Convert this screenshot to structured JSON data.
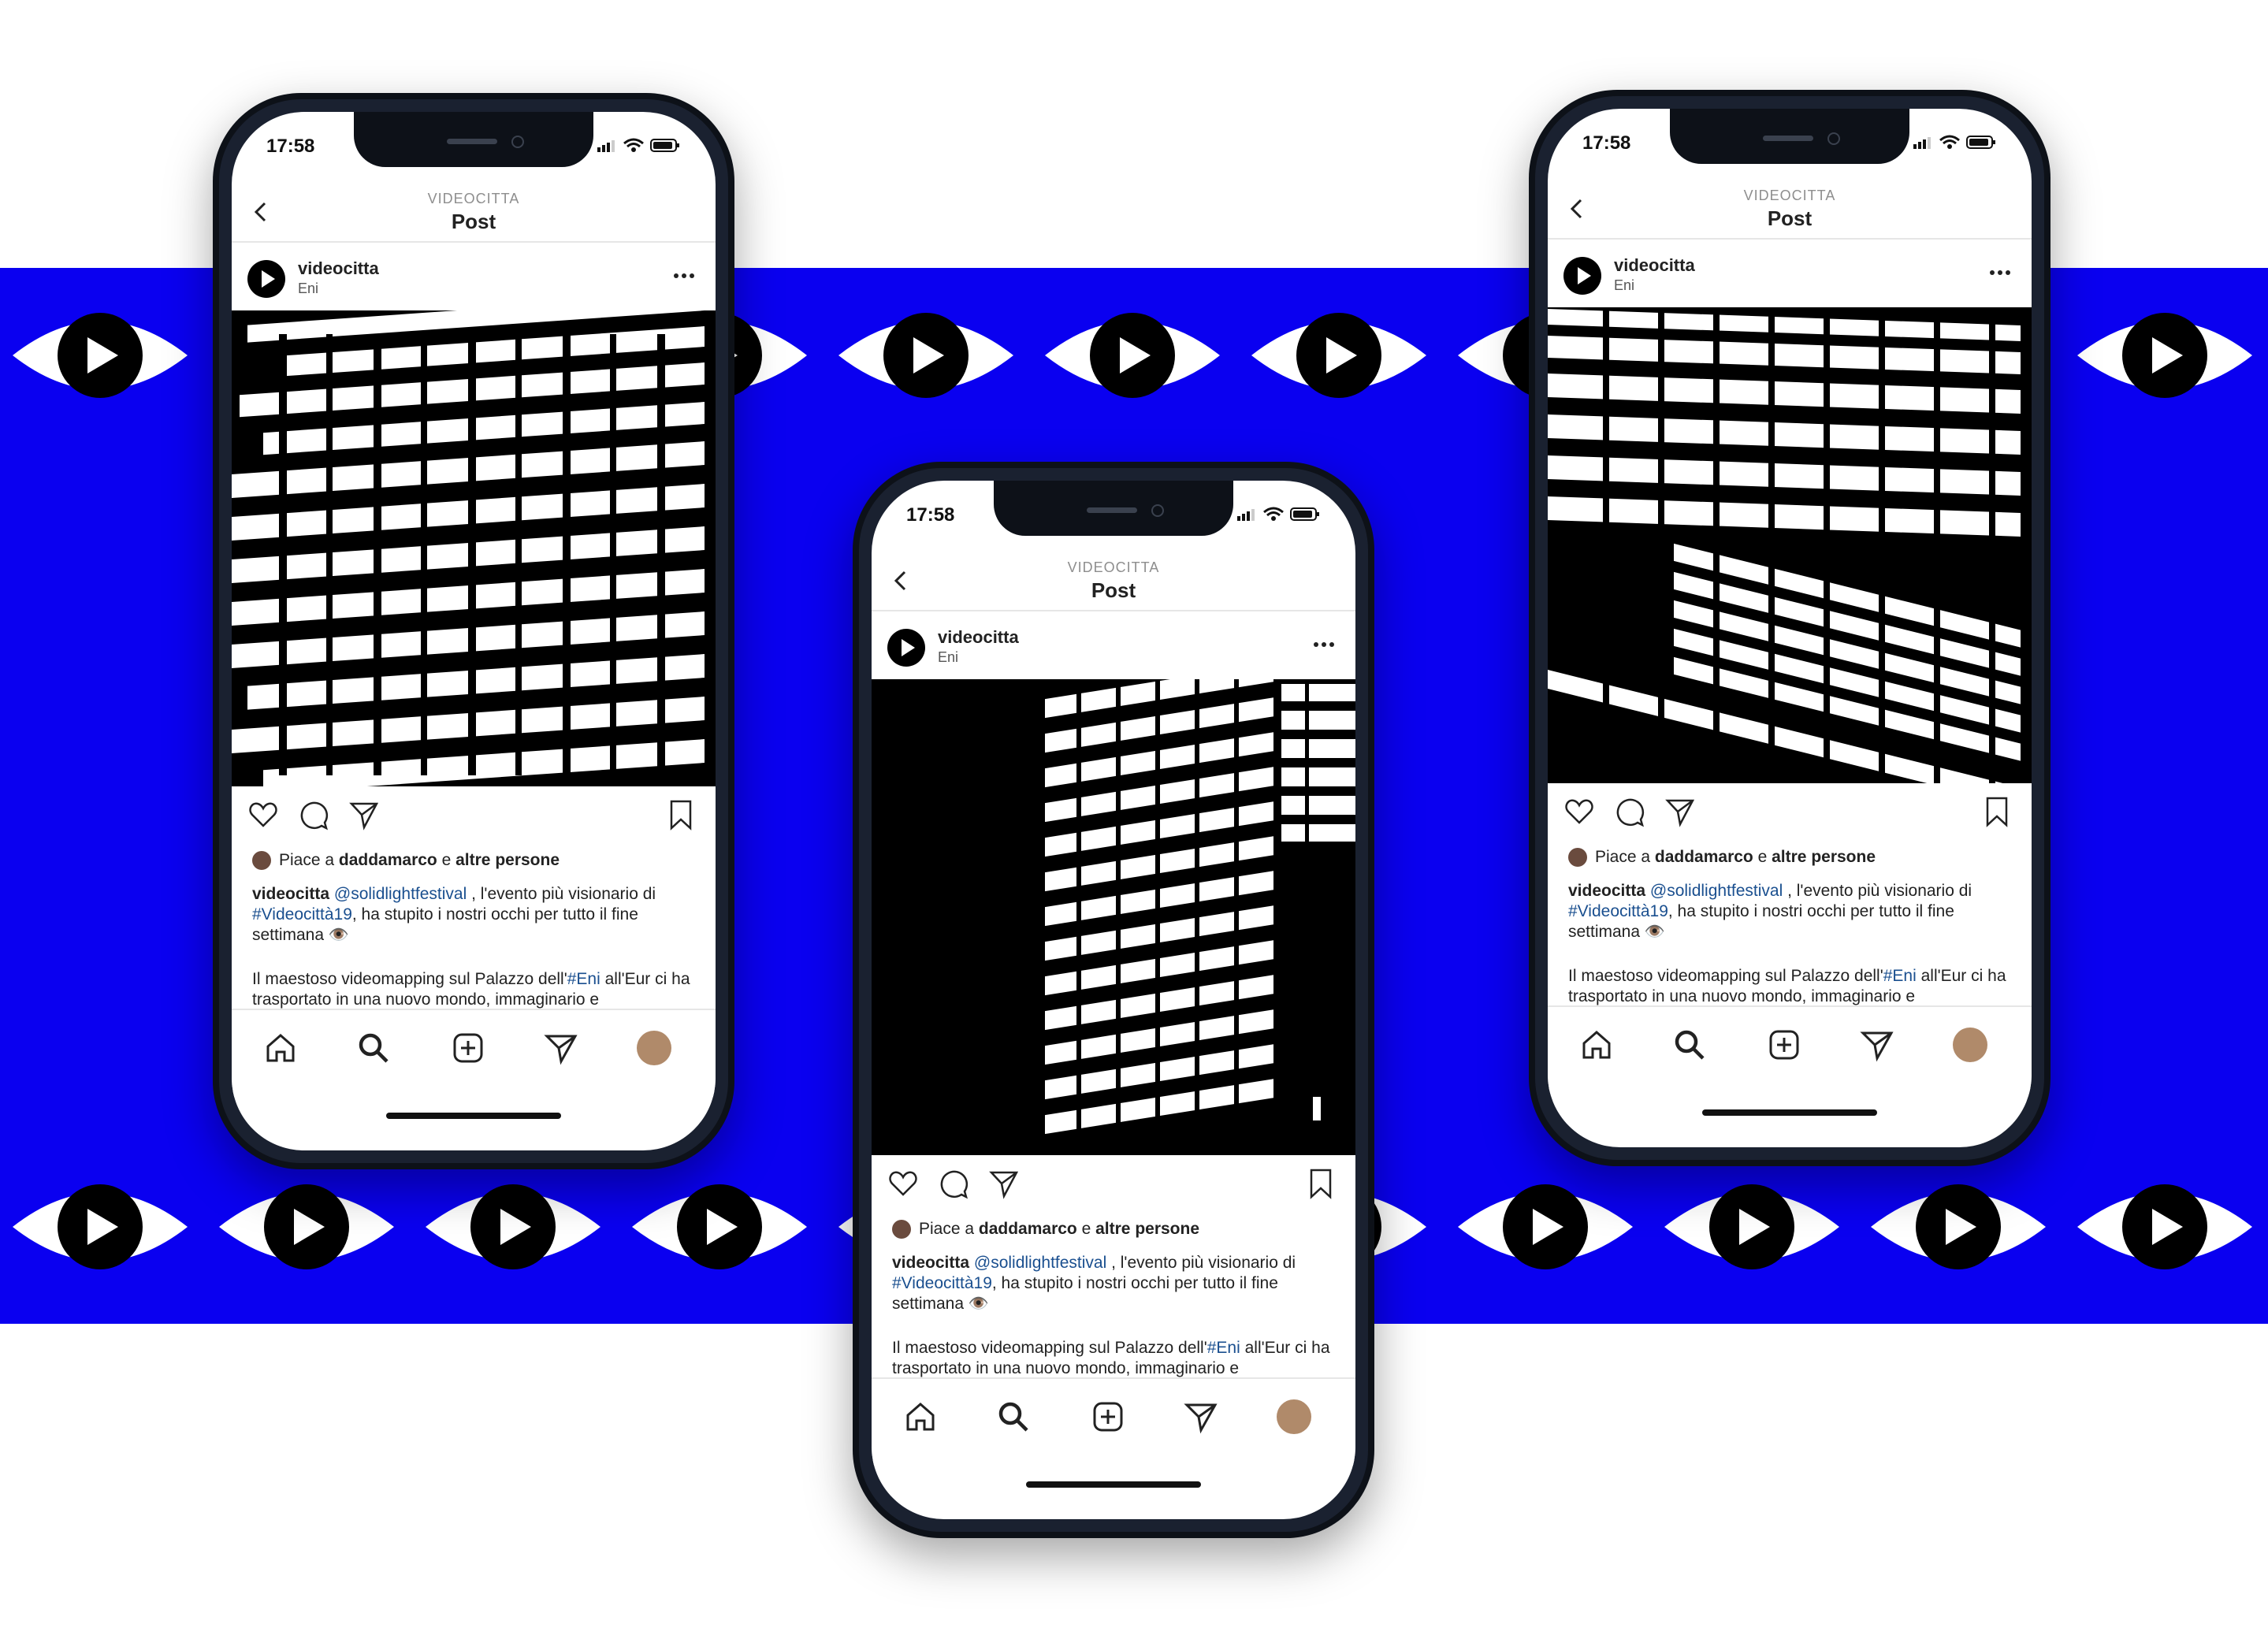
{
  "colors": {
    "band": "#0a00f0",
    "link": "#1a4f8f"
  },
  "eyes": {
    "icon": "eye-play-icon"
  },
  "phones": [
    {
      "time": "17:58",
      "header_sub": "VIDEOCITTA",
      "header_title": "Post",
      "username": "videocitta",
      "location": "Eni",
      "photo_type": "projection-letters-wall",
      "likes_prefix": "Piace a ",
      "likes_user": "daddamarco",
      "likes_mid": " e ",
      "likes_rest": "altre persone",
      "caption_user": "videocitta",
      "caption_mention": "@solidlightfestival",
      "caption_text1": " , l'evento più visionario di ",
      "caption_hashtag1": "#Videocittà19",
      "caption_text2": ", ha stupito i nostri occhi per tutto il fine settimana 👁️",
      "caption2_text1": "Il maestoso videomapping sul Palazzo dell'",
      "caption2_hashtag": "#Eni",
      "caption2_text2": " all'Eur ci ha trasportato in una nuovo mondo, immaginario e paradossale."
    },
    {
      "time": "17:58",
      "header_sub": "VIDEOCITTA",
      "header_title": "Post",
      "username": "videocitta",
      "location": "Eni",
      "photo_type": "projection-letters-facade",
      "likes_prefix": "Piace a ",
      "likes_user": "daddamarco",
      "likes_mid": " e ",
      "likes_rest": "altre persone",
      "caption_user": "videocitta",
      "caption_mention": "@solidlightfestival",
      "caption_text1": " , l'evento più visionario di ",
      "caption_hashtag1": "#Videocittà19",
      "caption_text2": ", ha stupito i nostri occhi per tutto il fine settimana 👁️",
      "caption2_text1": "Il maestoso videomapping sul Palazzo dell'",
      "caption2_hashtag": "#Eni",
      "caption2_text2": " all'Eur ci ha trasportato in una nuovo mondo, immaginario e paradossale."
    },
    {
      "time": "17:58",
      "header_sub": "VIDEOCITTA",
      "header_title": "Post",
      "username": "videocitta",
      "location": "Eni",
      "photo_type": "projection-letters-corner",
      "likes_prefix": "Piace a ",
      "likes_user": "daddamarco",
      "likes_mid": " e ",
      "likes_rest": "altre persone",
      "caption_user": "videocitta",
      "caption_mention": "@solidlightfestival",
      "caption_text1": " , l'evento più visionario di ",
      "caption_hashtag1": "#Videocittà19",
      "caption_text2": ", ha stupito i nostri occhi per tutto il fine settimana 👁️",
      "caption2_text1": "Il maestoso videomapping sul Palazzo dell'",
      "caption2_hashtag": "#Eni",
      "caption2_text2": " all'Eur ci ha trasportato in una nuovo mondo, immaginario e paradossale."
    }
  ]
}
